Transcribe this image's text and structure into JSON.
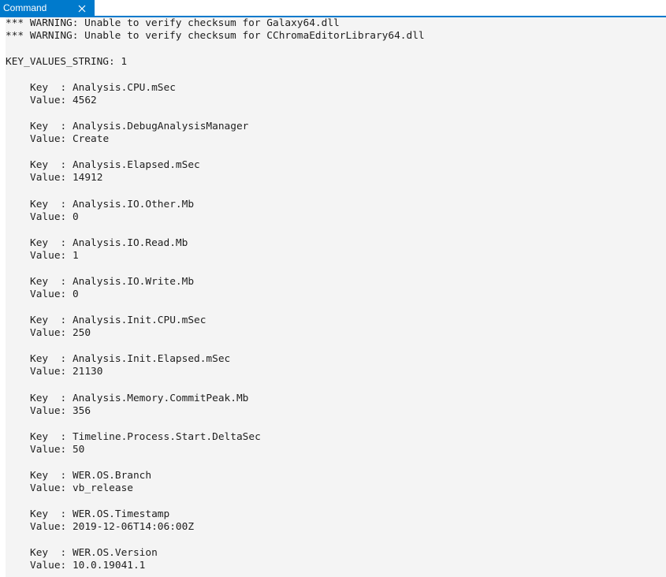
{
  "window": {
    "tab_label": "Command",
    "close_icon": "close-icon"
  },
  "output": {
    "warnings": [
      "*** WARNING: Unable to verify checksum for Galaxy64.dll",
      "*** WARNING: Unable to verify checksum for CChromaEditorLibrary64.dll"
    ],
    "kv_header": "KEY_VALUES_STRING: 1",
    "key_prefix": "Key  : ",
    "value_prefix": "Value: ",
    "entries": [
      {
        "key": "Analysis.CPU.mSec",
        "value": "4562"
      },
      {
        "key": "Analysis.DebugAnalysisManager",
        "value": "Create"
      },
      {
        "key": "Analysis.Elapsed.mSec",
        "value": "14912"
      },
      {
        "key": "Analysis.IO.Other.Mb",
        "value": "0"
      },
      {
        "key": "Analysis.IO.Read.Mb",
        "value": "1"
      },
      {
        "key": "Analysis.IO.Write.Mb",
        "value": "0"
      },
      {
        "key": "Analysis.Init.CPU.mSec",
        "value": "250"
      },
      {
        "key": "Analysis.Init.Elapsed.mSec",
        "value": "21130"
      },
      {
        "key": "Analysis.Memory.CommitPeak.Mb",
        "value": "356"
      },
      {
        "key": "Timeline.Process.Start.DeltaSec",
        "value": "50"
      },
      {
        "key": "WER.OS.Branch",
        "value": "vb_release"
      },
      {
        "key": "WER.OS.Timestamp",
        "value": "2019-12-06T14:06:00Z"
      },
      {
        "key": "WER.OS.Version",
        "value": "10.0.19041.1"
      }
    ]
  }
}
